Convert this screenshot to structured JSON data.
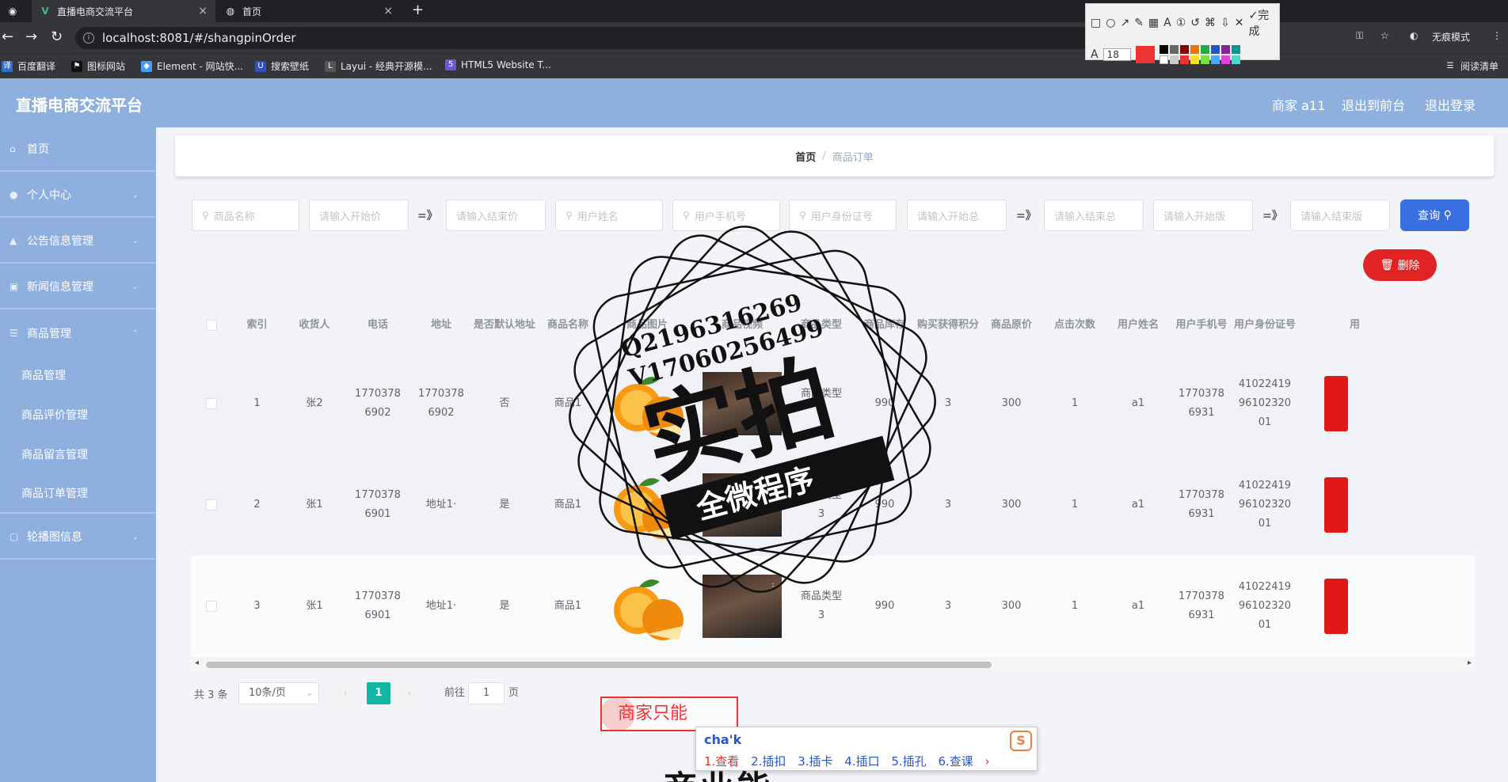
{
  "browser": {
    "tabs": [
      {
        "title": "直播电商交流平台",
        "icon": "vue-icon",
        "active": true
      },
      {
        "title": "首页",
        "icon": "globe-icon",
        "active": false
      }
    ],
    "url": "localhost:8081/#/shangpinOrder",
    "bookmarks": [
      "百度翻译",
      "图标网站",
      "Element - 网站快...",
      "搜索壁纸",
      "Layui - 经典开源模...",
      "HTML5 Website T..."
    ],
    "incognito_label": "无痕模式",
    "reading_list": "阅读清单",
    "drawtool": {
      "font_size": "18",
      "done_label": "完成",
      "current_color": "#ee3333"
    }
  },
  "app": {
    "title": "直播电商交流平台",
    "header_links": [
      "商家 a11",
      "退出到前台",
      "退出登录"
    ]
  },
  "sidebar": {
    "items": [
      {
        "label": "首页",
        "icon": "home-icon"
      },
      {
        "label": "个人中心",
        "icon": "user-icon"
      },
      {
        "label": "公告信息管理",
        "icon": "notice-icon"
      },
      {
        "label": "新闻信息管理",
        "icon": "news-icon"
      },
      {
        "label": "商品管理",
        "icon": "list-icon"
      }
    ],
    "subitems": [
      "商品管理",
      "商品评价管理",
      "商品留言管理",
      "商品订单管理"
    ],
    "last_item": {
      "label": "轮播图信息",
      "icon": "image-icon"
    }
  },
  "breadcrumb": {
    "home": "首页",
    "current": "商品订单"
  },
  "search": {
    "placeholders": [
      "商品名称",
      "请输入开始价",
      "请输入结束价",
      "用户姓名",
      "用户手机号",
      "用户身份证号",
      "请输入开始总",
      "请输入结束总",
      "请输入开始版",
      "请输入结束版"
    ],
    "range_sep": "=》",
    "query_label": "查询",
    "delete_label": "删除"
  },
  "table": {
    "headers": [
      "索引",
      "收货人",
      "电话",
      "地址",
      "是否默认地址",
      "商品名称",
      "商品图片",
      "商品视频",
      "商品类型",
      "商品库存",
      "购买获得积分",
      "商品原价",
      "点击次数",
      "用户姓名",
      "用户手机号",
      "用户身份证号",
      "用"
    ],
    "rows": [
      [
        "1",
        "张2",
        "17703786902",
        "17703786902",
        "否",
        "商品1",
        "",
        "",
        "商品类型3",
        "990",
        "3",
        "300",
        "1",
        "a1",
        "17703786931",
        "410224199610232001"
      ],
      [
        "2",
        "张1",
        "17703786901",
        "地址1·",
        "是",
        "商品1",
        "",
        "",
        "商品类型3",
        "990",
        "3",
        "300",
        "1",
        "a1",
        "17703786931",
        "410224199610232001"
      ],
      [
        "3",
        "张1",
        "17703786901",
        "地址1·",
        "是",
        "商品1",
        "",
        "",
        "商品类型3",
        "990",
        "3",
        "300",
        "1",
        "a1",
        "17703786931",
        "410224199610232001"
      ]
    ]
  },
  "pagination": {
    "total": "共 3 条",
    "page_size": "10条/页",
    "current": "1",
    "goto_label": "前往",
    "goto_value": "1",
    "page_suffix": "页"
  },
  "overlay": {
    "watermark_line1": "Q2196316269",
    "watermark_line2": "V17060256499",
    "watermark_main": "实拍",
    "watermark_banner": "全微程序",
    "annotation": "商家只能",
    "ime_input": "cha'k",
    "ime_candidates": [
      "1.查看",
      "2.插扣",
      "3.插卡",
      "4.插口",
      "5.插孔",
      "6.查课"
    ],
    "bottom_text": "商业能"
  }
}
